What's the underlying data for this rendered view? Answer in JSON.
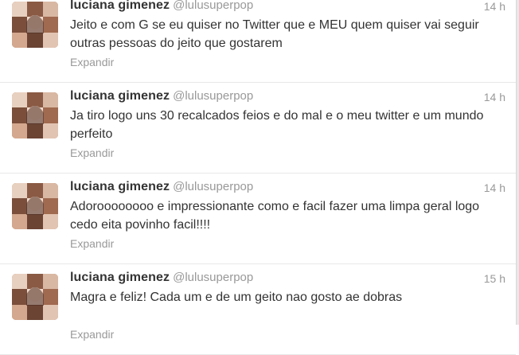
{
  "tweets": [
    {
      "fullname": "luciana gimenez",
      "username": "@lulusuperpop",
      "time": "14 h",
      "text": "Jeito e com G se eu quiser no Twitter que e MEU quem quiser vai seguir outras pessoas do jeito que gostarem",
      "expand": "Expandir"
    },
    {
      "fullname": "luciana gimenez",
      "username": "@lulusuperpop",
      "time": "14 h",
      "text": "Ja tiro logo uns 30 recalcados feios e do mal e o meu twitter e um mundo perfeito",
      "expand": "Expandir"
    },
    {
      "fullname": "luciana gimenez",
      "username": "@lulusuperpop",
      "time": "14 h",
      "text": "Adoroooooooo e impressionante como e facil fazer uma limpa geral logo cedo eita povinho facil!!!!",
      "expand": "Expandir"
    },
    {
      "fullname": "luciana gimenez",
      "username": "@lulusuperpop",
      "time": "15 h",
      "text": "Magra e feliz! Cada um e de um geito nao gosto ae dobras",
      "expand": "Expandir"
    }
  ]
}
